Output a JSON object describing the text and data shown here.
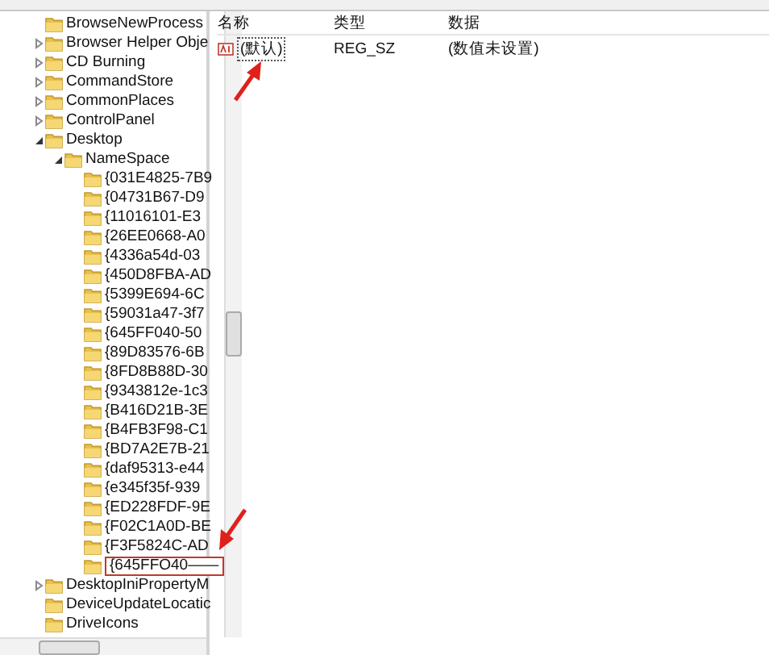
{
  "tree": [
    {
      "label": "BrowseNewProcess"
    },
    {
      "label": "Browser Helper Obje",
      "expanded": false
    },
    {
      "label": "CD Burning",
      "expanded": false
    },
    {
      "label": "CommandStore",
      "expanded": false
    },
    {
      "label": "CommonPlaces",
      "expanded": false
    },
    {
      "label": "ControlPanel",
      "expanded": false
    },
    {
      "label": "Desktop",
      "expanded": true,
      "children": [
        {
          "label": "NameSpace",
          "expanded": true,
          "children": [
            {
              "label": "{031E4825-7B9",
              "editing": false
            },
            {
              "label": "{04731B67-D9",
              "editing": false
            },
            {
              "label": "{11016101-E3",
              "editing": false
            },
            {
              "label": "{26EE0668-A0",
              "editing": false
            },
            {
              "label": "{4336a54d-03",
              "editing": false
            },
            {
              "label": "{450D8FBA-AD",
              "editing": false
            },
            {
              "label": "{5399E694-6C",
              "editing": false
            },
            {
              "label": "{59031a47-3f7",
              "editing": false
            },
            {
              "label": "{645FF040-50",
              "editing": false
            },
            {
              "label": "{89D83576-6B",
              "editing": false
            },
            {
              "label": "{8FD8B88D-30",
              "editing": false
            },
            {
              "label": "{9343812e-1c3",
              "editing": false
            },
            {
              "label": "{B416D21B-3E",
              "editing": false
            },
            {
              "label": "{B4FB3F98-C1",
              "editing": false
            },
            {
              "label": "{BD7A2E7B-21",
              "editing": false
            },
            {
              "label": "{daf95313-e44",
              "editing": false
            },
            {
              "label": "{e345f35f-939",
              "editing": false
            },
            {
              "label": "{ED228FDF-9E",
              "editing": false
            },
            {
              "label": "{F02C1A0D-BE",
              "editing": false
            },
            {
              "label": "{F3F5824C-AD",
              "editing": false
            },
            {
              "label": "{645FFO40——",
              "editing": true
            }
          ]
        }
      ]
    },
    {
      "label": "DesktopIniPropertyM",
      "expanded": false
    },
    {
      "label": "DeviceUpdateLocatic"
    },
    {
      "label": "DriveIcons"
    }
  ],
  "list": {
    "columns": [
      "名称",
      "类型",
      "数据"
    ],
    "rows": [
      {
        "name": "(默认)",
        "type": "REG_SZ",
        "data": "(数值未设置)",
        "selected": true
      }
    ]
  }
}
